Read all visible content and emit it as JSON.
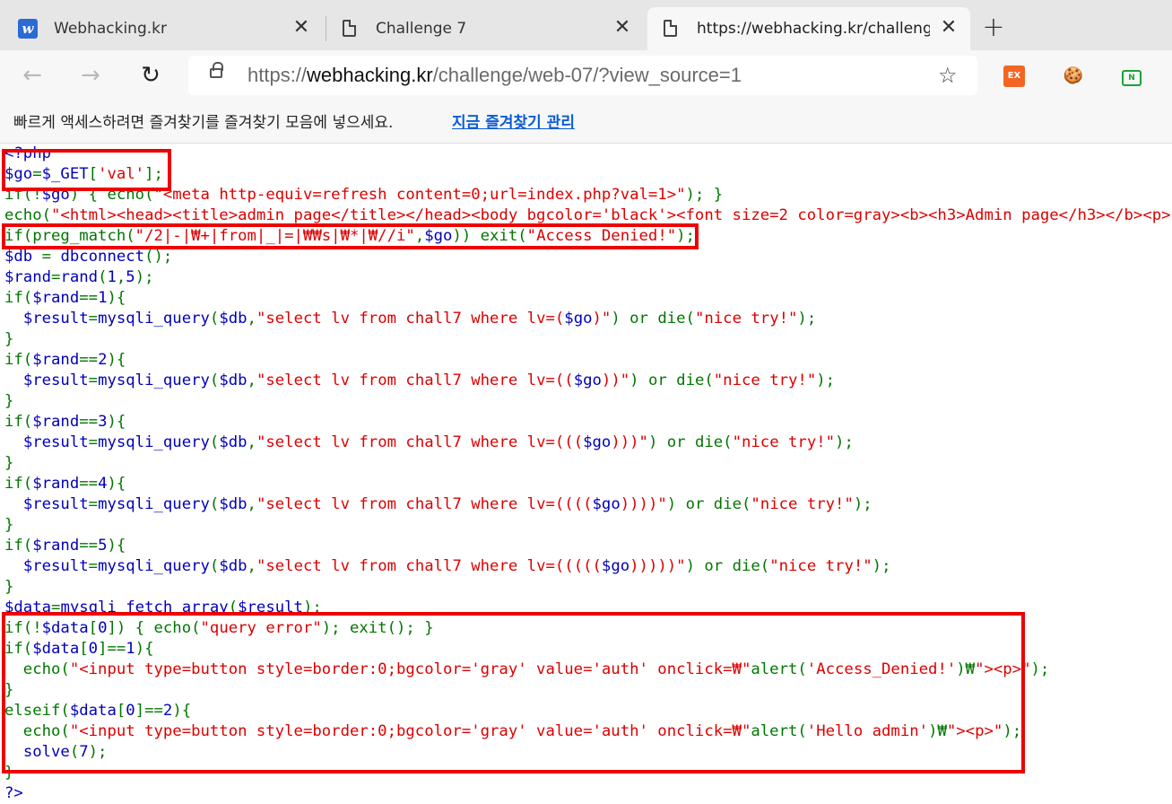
{
  "tabs": [
    {
      "title": "Webhacking.kr",
      "icon": "webhacking-favicon",
      "active": false
    },
    {
      "title": "Challenge 7",
      "icon": "document-icon",
      "active": false
    },
    {
      "title": "https://webhacking.kr/challenge/",
      "icon": "document-icon",
      "active": true
    }
  ],
  "toolbar": {
    "url_prefix": "https://",
    "url_host": "webhacking.kr",
    "url_path": "/challenge/web-07/?view_source=1",
    "extensions": [
      {
        "name": "ex-extension",
        "label": "EX",
        "color": "#f26522"
      },
      {
        "name": "cookie-extension",
        "label": "🍪",
        "color": "#c98a32"
      },
      {
        "name": "n-extension",
        "label": "N",
        "color": "#1aa33a"
      }
    ]
  },
  "favorites_bar": {
    "message": "빠르게 액세스하려면 즐겨찾기를 즐겨찾기 모음에 넣으세요.",
    "link": "지금 즐겨찾기 관리"
  },
  "code_lines": [
    "<?php",
    "$go=$_GET['val'];",
    "if(!$go) { echo(\"<meta http-equiv=refresh content=0;url=index.php?val=1>\"); }",
    "echo(\"<html><head><title>admin page</title></head><body bgcolor='black'><font size=2 color=gray><b><h3>Admin page</h3></b><p>\");",
    "if(preg_match(\"/2|-|₩+|from|_|=|₩₩s|₩*|₩//i\",$go)) exit(\"Access Denied!\");",
    "$db = dbconnect();",
    "$rand=rand(1,5);",
    "if($rand==1){",
    "  $result=mysqli_query($db,\"select lv from chall7 where lv=($go)\") or die(\"nice try!\");",
    "}",
    "if($rand==2){",
    "  $result=mysqli_query($db,\"select lv from chall7 where lv=(($go))\") or die(\"nice try!\");",
    "}",
    "if($rand==3){",
    "  $result=mysqli_query($db,\"select lv from chall7 where lv=((($go)))\") or die(\"nice try!\");",
    "}",
    "if($rand==4){",
    "  $result=mysqli_query($db,\"select lv from chall7 where lv=(((($go))))\") or die(\"nice try!\");",
    "}",
    "if($rand==5){",
    "  $result=mysqli_query($db,\"select lv from chall7 where lv=((((($go)))))\") or die(\"nice try!\");",
    "}",
    "$data=mysqli_fetch_array($result);",
    "if(!$data[0]) { echo(\"query error\"); exit(); }",
    "if($data[0]==1){",
    "  echo(\"<input type=button style=border:0;bgcolor='gray' value='auth' onclick=₩\"alert('Access_Denied!')₩\"><p>\");",
    "}",
    "elseif($data[0]==2){",
    "  echo(\"<input type=button style=border:0;bgcolor='gray' value='auth' onclick=₩\"alert('Hello admin')₩\"><p>\");",
    "  solve(7);",
    "}",
    "?>"
  ],
  "highlight_color": "#ee0000"
}
